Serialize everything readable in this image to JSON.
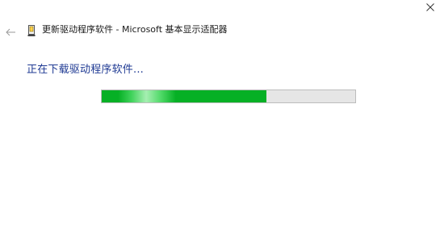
{
  "window": {
    "title": "更新驱动程序软件 - Microsoft 基本显示适配器",
    "icons": {
      "close": "close-icon",
      "back": "back-arrow-icon",
      "app": "device-driver-icon"
    }
  },
  "content": {
    "status_text": "正在下载驱动程序软件...",
    "progress": {
      "fraction": 0.65,
      "fill_color": "#06b025",
      "track_color": "#e6e6e6"
    }
  },
  "colors": {
    "accent_text": "#1f3a93"
  }
}
